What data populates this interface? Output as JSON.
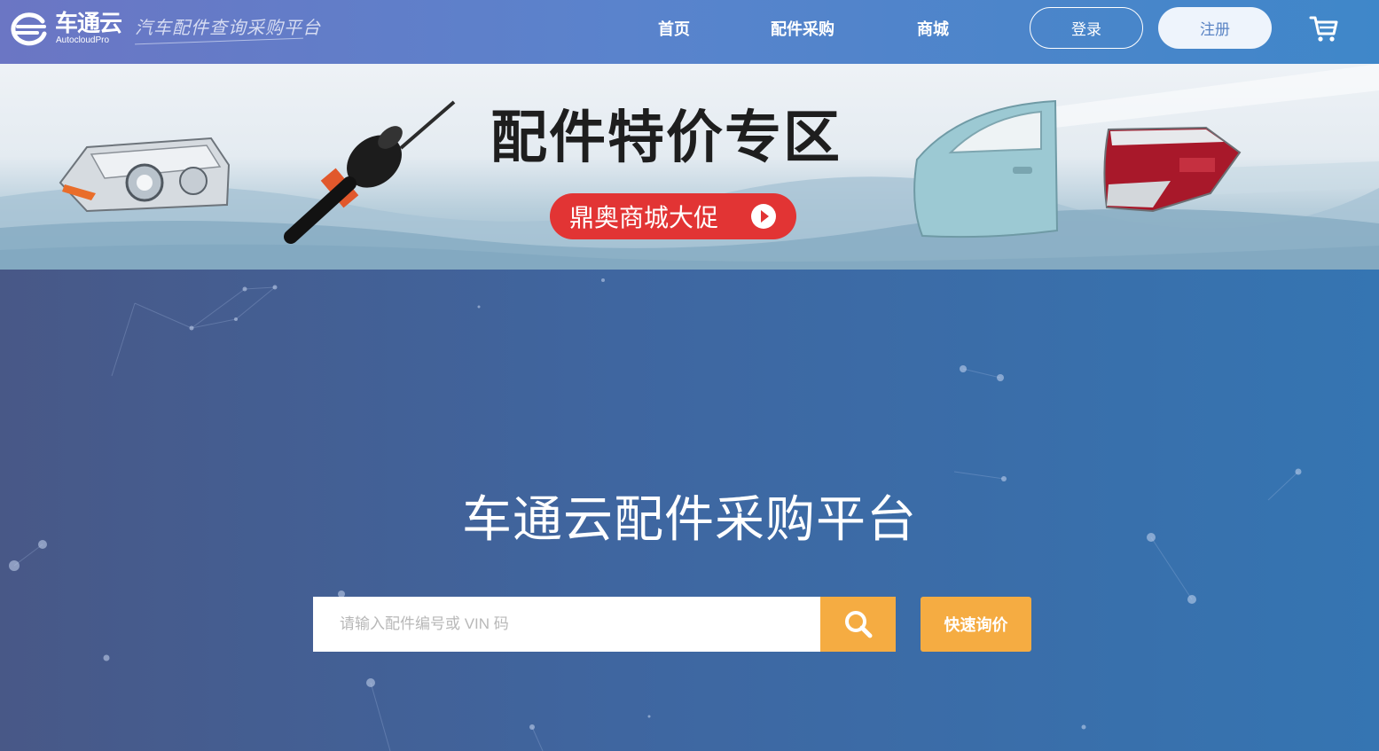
{
  "header": {
    "logo_name": "车通云",
    "logo_sub": "AutocloudPro",
    "slogan": "汽车配件查询采购平台",
    "nav": [
      {
        "label": "首页"
      },
      {
        "label": "配件采购"
      },
      {
        "label": "商城"
      }
    ],
    "login_label": "登录",
    "register_label": "注册",
    "cart_icon": "cart-icon"
  },
  "banner": {
    "title": "配件特价专区",
    "promo_label": "鼎奥商城大促",
    "promo_icon": "play-circle-icon"
  },
  "hero": {
    "title": "车通云配件采购平台",
    "search_placeholder": "请输入配件编号或 VIN 码",
    "search_value": "",
    "search_icon": "search-icon",
    "quote_label": "快速询价"
  },
  "colors": {
    "accent_orange": "#f5ac42",
    "promo_red": "#e23434",
    "header_start": "#6b76c4",
    "header_end": "#3f87c9"
  }
}
